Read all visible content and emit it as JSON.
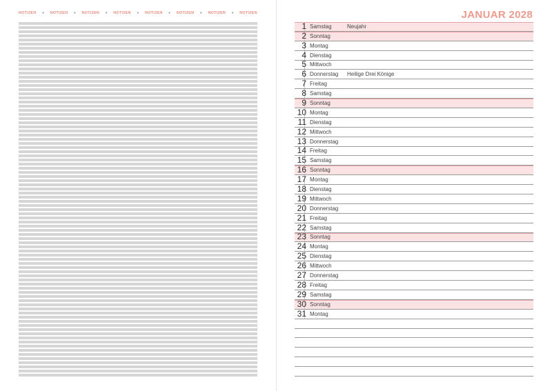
{
  "notes": {
    "header_words": [
      "NOTIZEN",
      "NOTIZEN",
      "NOTIZEN",
      "NOTIZEN",
      "NOTIZEN",
      "NOTIZEN",
      "NOTIZEN",
      "NOTIZEN"
    ],
    "separator": "•"
  },
  "calendar": {
    "title": "JANUAR 2028",
    "days": [
      {
        "num": "1",
        "name": "Samstag",
        "event": "Neujahr",
        "hl": true
      },
      {
        "num": "2",
        "name": "Sonntag",
        "event": "",
        "hl": true
      },
      {
        "num": "3",
        "name": "Montag",
        "event": "",
        "hl": false
      },
      {
        "num": "4",
        "name": "Dienstag",
        "event": "",
        "hl": false
      },
      {
        "num": "5",
        "name": "Mittwoch",
        "event": "",
        "hl": false
      },
      {
        "num": "6",
        "name": "Donnerstag",
        "event": "Heilige Drei Könige",
        "hl": false
      },
      {
        "num": "7",
        "name": "Freitag",
        "event": "",
        "hl": false
      },
      {
        "num": "8",
        "name": "Samstag",
        "event": "",
        "hl": false
      },
      {
        "num": "9",
        "name": "Sonntag",
        "event": "",
        "hl": true
      },
      {
        "num": "10",
        "name": "Montag",
        "event": "",
        "hl": false
      },
      {
        "num": "11",
        "name": "Dienstag",
        "event": "",
        "hl": false
      },
      {
        "num": "12",
        "name": "Mittwoch",
        "event": "",
        "hl": false
      },
      {
        "num": "13",
        "name": "Donnerstag",
        "event": "",
        "hl": false
      },
      {
        "num": "14",
        "name": "Freitag",
        "event": "",
        "hl": false
      },
      {
        "num": "15",
        "name": "Samstag",
        "event": "",
        "hl": false
      },
      {
        "num": "16",
        "name": "Sonntag",
        "event": "",
        "hl": true
      },
      {
        "num": "17",
        "name": "Montag",
        "event": "",
        "hl": false
      },
      {
        "num": "18",
        "name": "Dienstag",
        "event": "",
        "hl": false
      },
      {
        "num": "19",
        "name": "Mittwoch",
        "event": "",
        "hl": false
      },
      {
        "num": "20",
        "name": "Donnerstag",
        "event": "",
        "hl": false
      },
      {
        "num": "21",
        "name": "Freitag",
        "event": "",
        "hl": false
      },
      {
        "num": "22",
        "name": "Samstag",
        "event": "",
        "hl": false
      },
      {
        "num": "23",
        "name": "Sonntag",
        "event": "",
        "hl": true
      },
      {
        "num": "24",
        "name": "Montag",
        "event": "",
        "hl": false
      },
      {
        "num": "25",
        "name": "Dienstag",
        "event": "",
        "hl": false
      },
      {
        "num": "26",
        "name": "Mittwoch",
        "event": "",
        "hl": false
      },
      {
        "num": "27",
        "name": "Donnerstag",
        "event": "",
        "hl": false
      },
      {
        "num": "28",
        "name": "Freitag",
        "event": "",
        "hl": false
      },
      {
        "num": "29",
        "name": "Samstag",
        "event": "",
        "hl": false
      },
      {
        "num": "30",
        "name": "Sonntag",
        "event": "",
        "hl": true
      },
      {
        "num": "31",
        "name": "Montag",
        "event": "",
        "hl": false
      }
    ]
  },
  "colors": {
    "accent": "#ee9a8d",
    "sunday_fill": "#fbe3e4",
    "note_line": "#d6d6d6"
  }
}
